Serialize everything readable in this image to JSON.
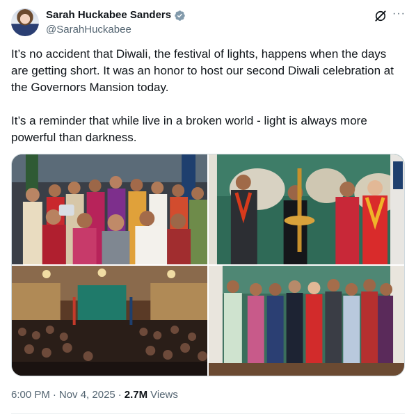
{
  "author": {
    "display_name": "Sarah Huckabee Sanders",
    "handle": "@SarahHuckabee",
    "verified": true,
    "verified_color": "#829aab"
  },
  "actions": {
    "grok_icon": "grok-icon",
    "more_icon": "more-options-icon",
    "more_label": "···"
  },
  "tweet": {
    "paragraph_1": "It’s no accident that Diwali, the festival of lights, happens when the days are getting short. It was an honor to host our second Diwali celebration at the Governors Mansion today.",
    "paragraph_2": "It’s a reminder that while live in a broken world - light is always more powerful than darkness."
  },
  "media": {
    "photos": [
      {
        "name": "group-selfie-photo"
      },
      {
        "name": "lamp-lighting-photo"
      },
      {
        "name": "audience-hall-photo"
      },
      {
        "name": "group-portrait-photo"
      }
    ]
  },
  "meta": {
    "time": "6:00 PM",
    "separator": "·",
    "date": "Nov 4, 2025",
    "views_count": "2.7M",
    "views_label": "Views"
  }
}
